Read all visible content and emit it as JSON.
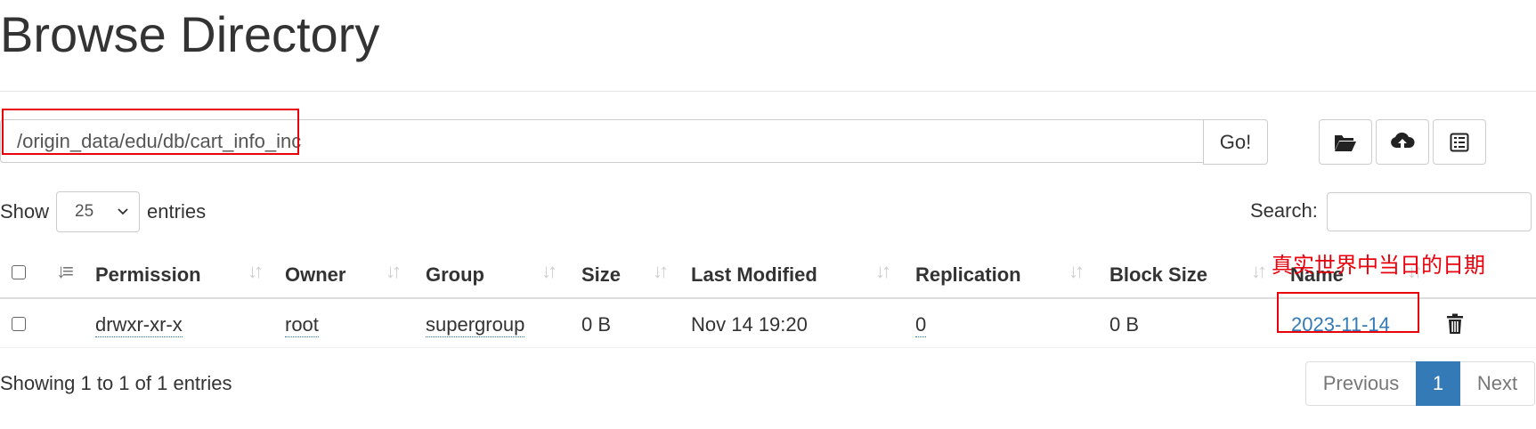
{
  "page": {
    "title": "Browse Directory"
  },
  "path_bar": {
    "value": "/origin_data/edu/db/cart_info_inc",
    "go_label": "Go!"
  },
  "toolbar": {
    "icons": [
      "folder-open-icon",
      "cloud-upload-icon",
      "list-icon"
    ]
  },
  "length_control": {
    "show_label": "Show",
    "selected": "25",
    "entries_label": "entries"
  },
  "search": {
    "label": "Search:",
    "value": ""
  },
  "table": {
    "headers": [
      "Permission",
      "Owner",
      "Group",
      "Size",
      "Last Modified",
      "Replication",
      "Block Size",
      "Name"
    ],
    "rows": [
      {
        "permission": "drwxr-xr-x",
        "owner": "root",
        "group": "supergroup",
        "size": "0 B",
        "last_modified": "Nov 14 19:20",
        "replication": "0",
        "block_size": "0 B",
        "name": "2023-11-14"
      }
    ]
  },
  "annotation": {
    "text": "真实世界中当日的日期",
    "color": "#e8000b"
  },
  "footer": {
    "info": "Showing 1 to 1 of 1 entries",
    "pagination": {
      "previous": "Previous",
      "current": "1",
      "next": "Next"
    }
  },
  "colors": {
    "link": "#337ab7",
    "active_page": "#337ab7",
    "annotation": "#e8000b"
  }
}
